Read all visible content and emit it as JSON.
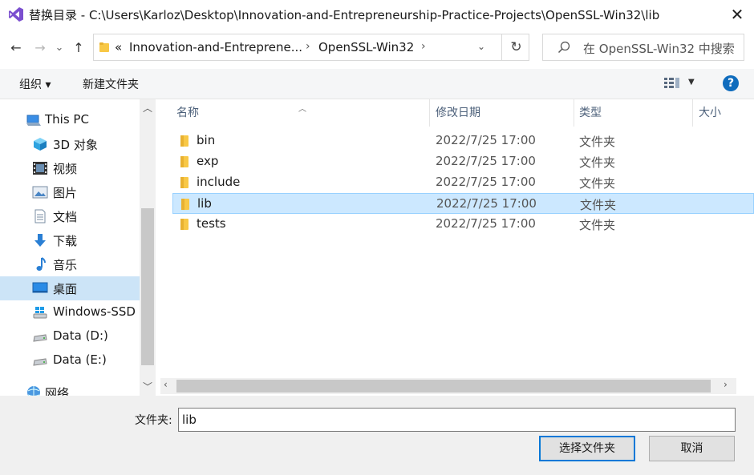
{
  "window": {
    "title": "替换目录 - C:\\Users\\Karloz\\Desktop\\Innovation-and-Entrepreneurship-Practice-Projects\\OpenSSL-Win32\\lib",
    "close_glyph": "✕"
  },
  "navigation": {
    "back_glyph": "←",
    "forward_glyph": "→",
    "recent_glyph": "⌄",
    "up_glyph": "↑",
    "address": {
      "overflow": "«",
      "segments": [
        "Innovation-and-Entreprene...",
        "OpenSSL-Win32"
      ],
      "separator": "›",
      "dropdown_glyph": "⌄",
      "refresh_glyph": "↻"
    },
    "search_placeholder": "在 OpenSSL-Win32 中搜索"
  },
  "toolbar": {
    "organize_label": "组织 ▾",
    "new_folder_label": "新建文件夹",
    "view_dropdown_glyph": "▼",
    "help_label": "?"
  },
  "sidebar": {
    "items": [
      {
        "label": "This PC",
        "icon": "pc-icon",
        "selected": false
      },
      {
        "label": "3D 对象",
        "icon": "3d-objects-icon",
        "selected": false
      },
      {
        "label": "视频",
        "icon": "video-icon",
        "selected": false
      },
      {
        "label": "图片",
        "icon": "pictures-icon",
        "selected": false
      },
      {
        "label": "文档",
        "icon": "documents-icon",
        "selected": false
      },
      {
        "label": "下载",
        "icon": "download-icon",
        "selected": false
      },
      {
        "label": "音乐",
        "icon": "music-icon",
        "selected": false
      },
      {
        "label": "桌面",
        "icon": "desktop-icon",
        "selected": true
      },
      {
        "label": "Windows-SSD",
        "icon": "windows-drive-icon",
        "selected": false
      },
      {
        "label": "Data (D:)",
        "icon": "drive-icon",
        "selected": false
      },
      {
        "label": "Data (E:)",
        "icon": "drive-icon",
        "selected": false
      },
      {
        "label": "网络",
        "icon": "network-icon",
        "selected": false
      }
    ],
    "scroll_up_glyph": "︿",
    "scroll_down_glyph": "﹀"
  },
  "file_list": {
    "columns": {
      "name": "名称",
      "modified": "修改日期",
      "type": "类型",
      "size": "大小"
    },
    "sort_glyph": "︿",
    "rows": [
      {
        "name": "bin",
        "modified": "2022/7/25 17:00",
        "type": "文件夹",
        "selected": false
      },
      {
        "name": "exp",
        "modified": "2022/7/25 17:00",
        "type": "文件夹",
        "selected": false
      },
      {
        "name": "include",
        "modified": "2022/7/25 17:00",
        "type": "文件夹",
        "selected": false
      },
      {
        "name": "lib",
        "modified": "2022/7/25 17:00",
        "type": "文件夹",
        "selected": true
      },
      {
        "name": "tests",
        "modified": "2022/7/25 17:00",
        "type": "文件夹",
        "selected": false
      }
    ],
    "hscroll_left_glyph": "‹",
    "hscroll_right_glyph": "›"
  },
  "footer": {
    "folder_label": "文件夹:",
    "folder_value": "lib",
    "select_button": "选择文件夹",
    "cancel_button": "取消"
  },
  "colors": {
    "selection_bg": "#cce8ff",
    "selection_border": "#99d1ff",
    "nav_selected_bg": "#cce4f7",
    "folder_yellow": "#f8c846",
    "accent_blue": "#0078d7"
  }
}
